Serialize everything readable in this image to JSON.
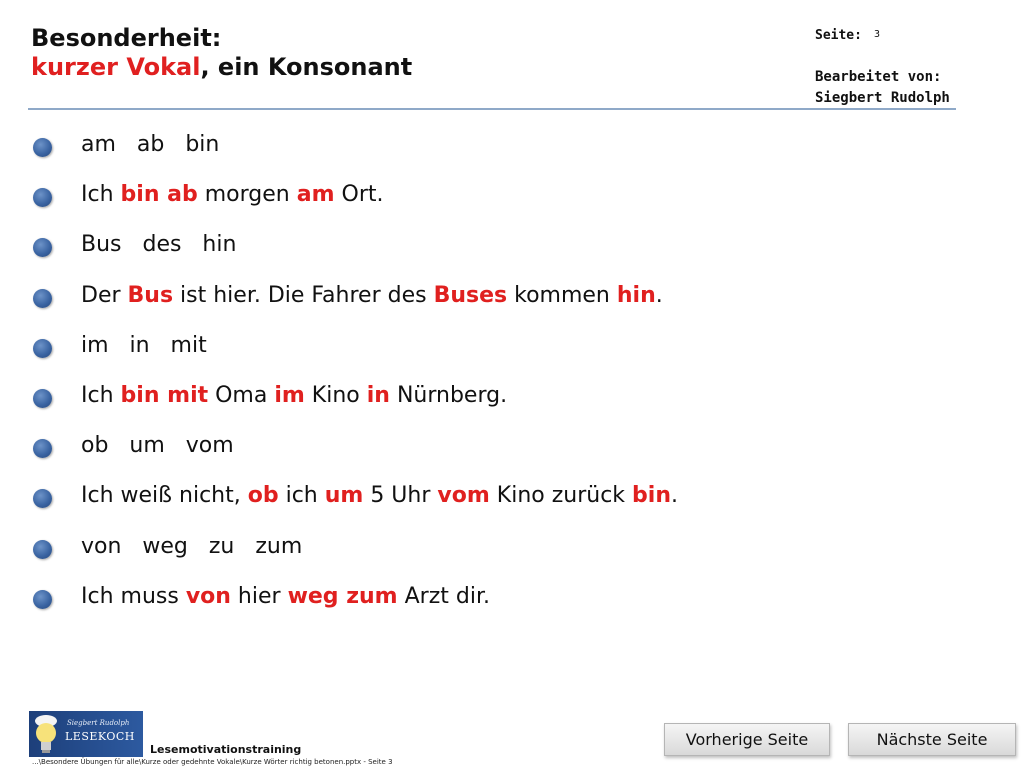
{
  "header": {
    "title_line1": "Besonderheit:",
    "title_line2_red": "kurzer Vokal",
    "title_line2_rest": ", ein Konsonant",
    "page_label": "Seite:",
    "page_number": "3",
    "editor_label": "Bearbeitet von:",
    "editor_name": "Siegbert Rudolph"
  },
  "lines": [
    [
      {
        "t": "am   ab   bin",
        "h": false
      }
    ],
    [
      {
        "t": "Ich ",
        "h": false
      },
      {
        "t": "bin ab",
        "h": true
      },
      {
        "t": " morgen ",
        "h": false
      },
      {
        "t": "am",
        "h": true
      },
      {
        "t": " Ort.",
        "h": false
      }
    ],
    [
      {
        "t": "Bus   des   hin",
        "h": false
      }
    ],
    [
      {
        "t": "Der ",
        "h": false
      },
      {
        "t": "Bus",
        "h": true
      },
      {
        "t": " ist hier. Die Fahrer des ",
        "h": false
      },
      {
        "t": "Buses",
        "h": true
      },
      {
        "t": " kommen ",
        "h": false
      },
      {
        "t": "hin",
        "h": true
      },
      {
        "t": ".",
        "h": false
      }
    ],
    [
      {
        "t": "im   in   mit",
        "h": false
      }
    ],
    [
      {
        "t": "Ich ",
        "h": false
      },
      {
        "t": "bin mit",
        "h": true
      },
      {
        "t": " Oma ",
        "h": false
      },
      {
        "t": "im",
        "h": true
      },
      {
        "t": " Kino ",
        "h": false
      },
      {
        "t": "in",
        "h": true
      },
      {
        "t": " Nürnberg.",
        "h": false
      }
    ],
    [
      {
        "t": "ob   um   vom",
        "h": false
      }
    ],
    [
      {
        "t": "Ich weiß nicht, ",
        "h": false
      },
      {
        "t": "ob",
        "h": true
      },
      {
        "t": " ich ",
        "h": false
      },
      {
        "t": "um",
        "h": true
      },
      {
        "t": " 5 Uhr ",
        "h": false
      },
      {
        "t": "vom",
        "h": true
      },
      {
        "t": " Kino zurück ",
        "h": false
      },
      {
        "t": "bin",
        "h": true
      },
      {
        "t": ".",
        "h": false
      }
    ],
    [
      {
        "t": "von   weg   zu   zum",
        "h": false
      }
    ],
    [
      {
        "t": "Ich muss ",
        "h": false
      },
      {
        "t": "von",
        "h": true
      },
      {
        "t": " hier ",
        "h": false
      },
      {
        "t": "weg zum",
        "h": true
      },
      {
        "t": " Arzt dir.",
        "h": false
      }
    ]
  ],
  "footer": {
    "logo_name": "Siegbert Rudolph",
    "logo_brand": "LESEKOCH",
    "training_label": "Lesemotivationstraining",
    "file_path": "...\\Besondere Übungen für alle\\Kurze oder gedehnte Vokale\\Kurze Wörter richtig betonen.pptx - Seite 3"
  },
  "nav": {
    "prev_label": "Vorherige Seite",
    "next_label": "Nächste Seite"
  },
  "colors": {
    "highlight": "#e0201f",
    "bullet": "#3b65a3",
    "rule": "#8fa9c8"
  },
  "icons": {
    "bullet": "blue-sphere-bullet-icon",
    "logo": "lightbulb-chef-logo-icon"
  }
}
